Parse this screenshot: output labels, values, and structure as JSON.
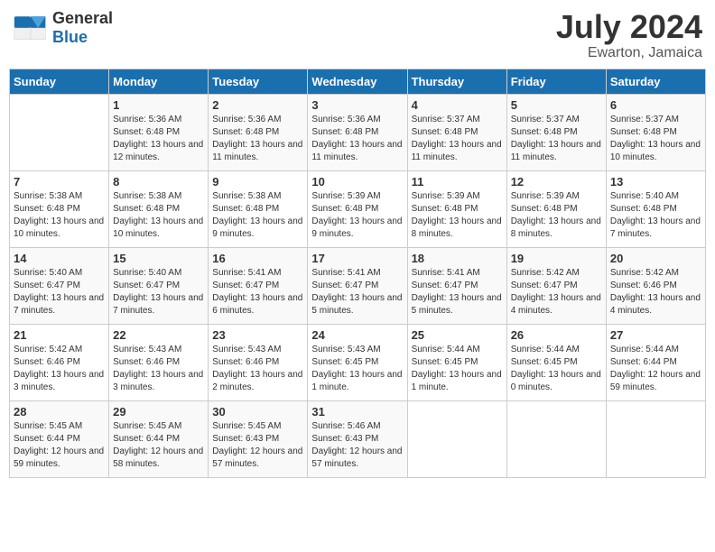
{
  "header": {
    "logo_text_general": "General",
    "logo_text_blue": "Blue",
    "month": "July 2024",
    "location": "Ewarton, Jamaica"
  },
  "weekdays": [
    "Sunday",
    "Monday",
    "Tuesday",
    "Wednesday",
    "Thursday",
    "Friday",
    "Saturday"
  ],
  "weeks": [
    [
      {
        "day": "",
        "sunrise": "",
        "sunset": "",
        "daylight": ""
      },
      {
        "day": "1",
        "sunrise": "Sunrise: 5:36 AM",
        "sunset": "Sunset: 6:48 PM",
        "daylight": "Daylight: 13 hours and 12 minutes."
      },
      {
        "day": "2",
        "sunrise": "Sunrise: 5:36 AM",
        "sunset": "Sunset: 6:48 PM",
        "daylight": "Daylight: 13 hours and 11 minutes."
      },
      {
        "day": "3",
        "sunrise": "Sunrise: 5:36 AM",
        "sunset": "Sunset: 6:48 PM",
        "daylight": "Daylight: 13 hours and 11 minutes."
      },
      {
        "day": "4",
        "sunrise": "Sunrise: 5:37 AM",
        "sunset": "Sunset: 6:48 PM",
        "daylight": "Daylight: 13 hours and 11 minutes."
      },
      {
        "day": "5",
        "sunrise": "Sunrise: 5:37 AM",
        "sunset": "Sunset: 6:48 PM",
        "daylight": "Daylight: 13 hours and 11 minutes."
      },
      {
        "day": "6",
        "sunrise": "Sunrise: 5:37 AM",
        "sunset": "Sunset: 6:48 PM",
        "daylight": "Daylight: 13 hours and 10 minutes."
      }
    ],
    [
      {
        "day": "7",
        "sunrise": "Sunrise: 5:38 AM",
        "sunset": "Sunset: 6:48 PM",
        "daylight": "Daylight: 13 hours and 10 minutes."
      },
      {
        "day": "8",
        "sunrise": "Sunrise: 5:38 AM",
        "sunset": "Sunset: 6:48 PM",
        "daylight": "Daylight: 13 hours and 10 minutes."
      },
      {
        "day": "9",
        "sunrise": "Sunrise: 5:38 AM",
        "sunset": "Sunset: 6:48 PM",
        "daylight": "Daylight: 13 hours and 9 minutes."
      },
      {
        "day": "10",
        "sunrise": "Sunrise: 5:39 AM",
        "sunset": "Sunset: 6:48 PM",
        "daylight": "Daylight: 13 hours and 9 minutes."
      },
      {
        "day": "11",
        "sunrise": "Sunrise: 5:39 AM",
        "sunset": "Sunset: 6:48 PM",
        "daylight": "Daylight: 13 hours and 8 minutes."
      },
      {
        "day": "12",
        "sunrise": "Sunrise: 5:39 AM",
        "sunset": "Sunset: 6:48 PM",
        "daylight": "Daylight: 13 hours and 8 minutes."
      },
      {
        "day": "13",
        "sunrise": "Sunrise: 5:40 AM",
        "sunset": "Sunset: 6:48 PM",
        "daylight": "Daylight: 13 hours and 7 minutes."
      }
    ],
    [
      {
        "day": "14",
        "sunrise": "Sunrise: 5:40 AM",
        "sunset": "Sunset: 6:47 PM",
        "daylight": "Daylight: 13 hours and 7 minutes."
      },
      {
        "day": "15",
        "sunrise": "Sunrise: 5:40 AM",
        "sunset": "Sunset: 6:47 PM",
        "daylight": "Daylight: 13 hours and 7 minutes."
      },
      {
        "day": "16",
        "sunrise": "Sunrise: 5:41 AM",
        "sunset": "Sunset: 6:47 PM",
        "daylight": "Daylight: 13 hours and 6 minutes."
      },
      {
        "day": "17",
        "sunrise": "Sunrise: 5:41 AM",
        "sunset": "Sunset: 6:47 PM",
        "daylight": "Daylight: 13 hours and 5 minutes."
      },
      {
        "day": "18",
        "sunrise": "Sunrise: 5:41 AM",
        "sunset": "Sunset: 6:47 PM",
        "daylight": "Daylight: 13 hours and 5 minutes."
      },
      {
        "day": "19",
        "sunrise": "Sunrise: 5:42 AM",
        "sunset": "Sunset: 6:47 PM",
        "daylight": "Daylight: 13 hours and 4 minutes."
      },
      {
        "day": "20",
        "sunrise": "Sunrise: 5:42 AM",
        "sunset": "Sunset: 6:46 PM",
        "daylight": "Daylight: 13 hours and 4 minutes."
      }
    ],
    [
      {
        "day": "21",
        "sunrise": "Sunrise: 5:42 AM",
        "sunset": "Sunset: 6:46 PM",
        "daylight": "Daylight: 13 hours and 3 minutes."
      },
      {
        "day": "22",
        "sunrise": "Sunrise: 5:43 AM",
        "sunset": "Sunset: 6:46 PM",
        "daylight": "Daylight: 13 hours and 3 minutes."
      },
      {
        "day": "23",
        "sunrise": "Sunrise: 5:43 AM",
        "sunset": "Sunset: 6:46 PM",
        "daylight": "Daylight: 13 hours and 2 minutes."
      },
      {
        "day": "24",
        "sunrise": "Sunrise: 5:43 AM",
        "sunset": "Sunset: 6:45 PM",
        "daylight": "Daylight: 13 hours and 1 minute."
      },
      {
        "day": "25",
        "sunrise": "Sunrise: 5:44 AM",
        "sunset": "Sunset: 6:45 PM",
        "daylight": "Daylight: 13 hours and 1 minute."
      },
      {
        "day": "26",
        "sunrise": "Sunrise: 5:44 AM",
        "sunset": "Sunset: 6:45 PM",
        "daylight": "Daylight: 13 hours and 0 minutes."
      },
      {
        "day": "27",
        "sunrise": "Sunrise: 5:44 AM",
        "sunset": "Sunset: 6:44 PM",
        "daylight": "Daylight: 12 hours and 59 minutes."
      }
    ],
    [
      {
        "day": "28",
        "sunrise": "Sunrise: 5:45 AM",
        "sunset": "Sunset: 6:44 PM",
        "daylight": "Daylight: 12 hours and 59 minutes."
      },
      {
        "day": "29",
        "sunrise": "Sunrise: 5:45 AM",
        "sunset": "Sunset: 6:44 PM",
        "daylight": "Daylight: 12 hours and 58 minutes."
      },
      {
        "day": "30",
        "sunrise": "Sunrise: 5:45 AM",
        "sunset": "Sunset: 6:43 PM",
        "daylight": "Daylight: 12 hours and 57 minutes."
      },
      {
        "day": "31",
        "sunrise": "Sunrise: 5:46 AM",
        "sunset": "Sunset: 6:43 PM",
        "daylight": "Daylight: 12 hours and 57 minutes."
      },
      {
        "day": "",
        "sunrise": "",
        "sunset": "",
        "daylight": ""
      },
      {
        "day": "",
        "sunrise": "",
        "sunset": "",
        "daylight": ""
      },
      {
        "day": "",
        "sunrise": "",
        "sunset": "",
        "daylight": ""
      }
    ]
  ]
}
